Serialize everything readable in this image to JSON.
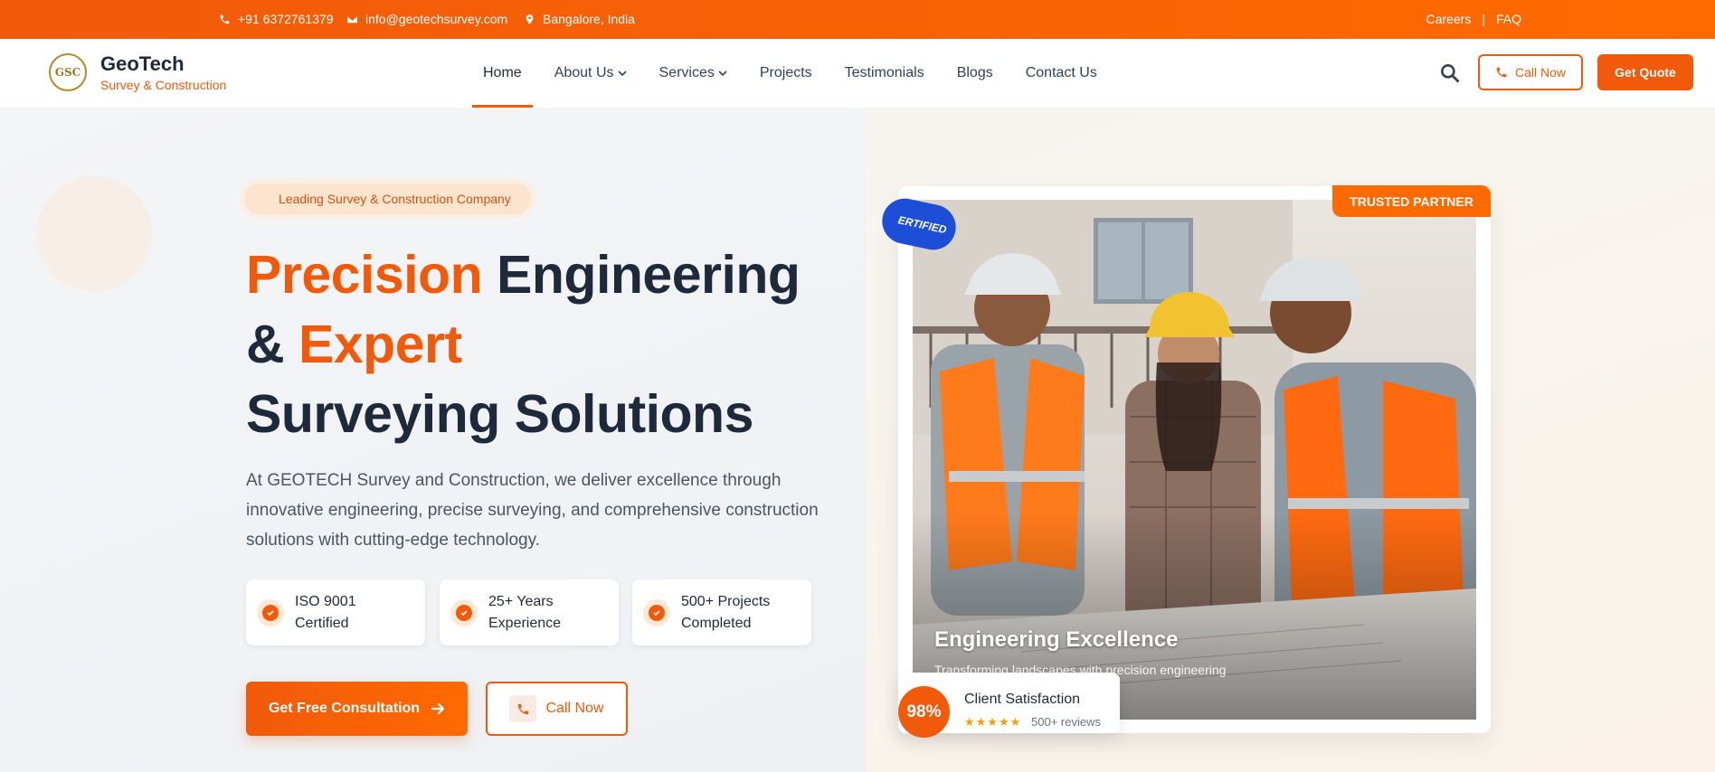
{
  "topbar": {
    "phone": "+91 6372761379",
    "email": "info@geotechsurvey.com",
    "location": "Bangalore, India",
    "careers": "Careers",
    "separator": "|",
    "faq": "FAQ"
  },
  "brand": {
    "mark": "GSC",
    "name": "GeoTech",
    "tagline": "Survey & Construction"
  },
  "nav": {
    "items": [
      {
        "label": "Home",
        "active": true
      },
      {
        "label": "About Us",
        "dropdown": true
      },
      {
        "label": "Services",
        "dropdown": true
      },
      {
        "label": "Projects"
      },
      {
        "label": "Testimonials"
      },
      {
        "label": "Blogs"
      },
      {
        "label": "Contact Us"
      }
    ],
    "call_label": "Call Now",
    "quote_label": "Get Quote"
  },
  "hero": {
    "badge": "Leading Survey & Construction Company",
    "title": {
      "w1": "Precision",
      "w2": " Engineering",
      "w3": "& ",
      "w4": "Expert",
      "w5": "Surveying Solutions"
    },
    "description": "At GEOTECH Survey and Construction, we deliver excellence through innovative engineering, precise surveying, and comprehensive construction solutions with cutting-edge technology.",
    "features": [
      {
        "line1": "ISO 9001",
        "line2": "Certified"
      },
      {
        "line1": "25+ Years",
        "line2": "Experience"
      },
      {
        "line1": "500+ Projects",
        "line2": "Completed"
      }
    ],
    "primary_cta": "Get Free Consultation",
    "secondary_cta": "Call Now"
  },
  "image_card": {
    "trusted": "TRUSTED PARTNER",
    "certified": "ERTIFIED",
    "caption_title": "Engineering Excellence",
    "caption_sub": "Transforming landscapes with precision engineering",
    "satisfaction_value": "98%",
    "satisfaction_label": "Client Satisfaction",
    "stars": "★★★★★",
    "reviews": "500+ reviews"
  },
  "colors": {
    "accent": "#f15a0a",
    "dark": "#1e293b",
    "certified_blue": "#1d4ed8",
    "star": "#f59e0b"
  }
}
